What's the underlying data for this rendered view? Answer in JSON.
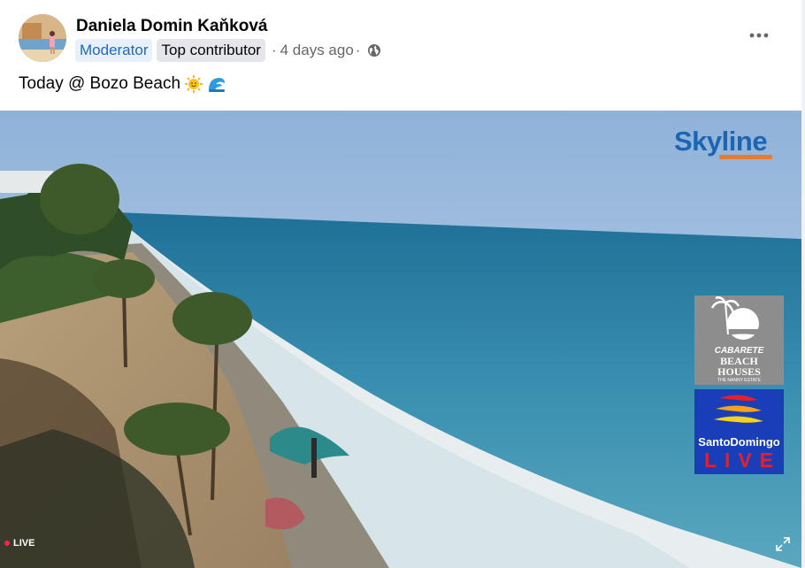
{
  "post": {
    "author": "Daniela Domin Kaňková",
    "badges": [
      "Moderator",
      "Top contributor"
    ],
    "time": "4 days ago",
    "separator": "·",
    "privacy_icon": "globe-icon",
    "text": "Today @ Bozo Beach",
    "emojis": [
      "sun-emoji",
      "wave-emoji"
    ],
    "more_icon": "more-horizontal-icon"
  },
  "video": {
    "live_label": "LIVE",
    "overlay_brand": "Skyline",
    "ads": {
      "cabarete_line1": "CABARETE",
      "cabarete_line2": "BEACH",
      "cabarete_line3": "HOUSES",
      "cabarete_tagline": "THE NANNY ESTATE",
      "santo_domingo": "SantoDomingo",
      "santo_domingo_live": "LIVE"
    },
    "expand_icon": "expand-icon"
  },
  "colors": {
    "moderator_badge_bg": "#e7f0fb",
    "moderator_badge_text": "#1b6ac9",
    "secondary_text": "#65676b",
    "live_dot": "#f02849",
    "skyline_blue": "#1b65b3"
  }
}
